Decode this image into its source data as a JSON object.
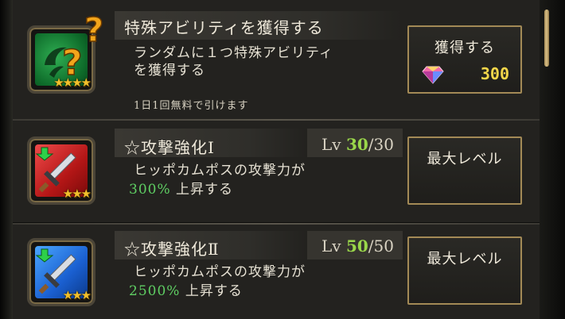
{
  "rows": [
    {
      "title": "特殊アビリティを獲得する",
      "desc_line1": "ランダムに１つ特殊アビリティ",
      "desc_line2": "を獲得する",
      "note": "1日1回無料で引けます",
      "icon": "mystery-ability-icon",
      "stars": "★★★★",
      "button_label": "獲得する",
      "price": "300",
      "currency_icon": "gem-icon"
    },
    {
      "title": "☆攻撃強化Ⅰ",
      "lv_label": "Lv",
      "lv_current": "30",
      "lv_max": "/30",
      "desc_line1": "ヒッポカムポスの攻撃力が",
      "desc_pct": "300%",
      "desc_suffix": " 上昇する",
      "icon": "sword-red-icon",
      "stars": "★★★",
      "button_label": "最大レベル"
    },
    {
      "title": "☆攻撃強化Ⅱ",
      "lv_label": "Lv",
      "lv_current": "50",
      "lv_max": "/50",
      "desc_line1": "ヒッポカムポスの攻撃力が",
      "desc_pct": "2500%",
      "desc_suffix": " 上昇する",
      "icon": "sword-blue-icon",
      "stars": "★★★",
      "button_label": "最大レベル"
    }
  ],
  "colors": {
    "accent_gold": "#a38a56",
    "level_green": "#9ad74a",
    "percent_green": "#5fcf63",
    "price_yellow": "#f3d64a"
  }
}
